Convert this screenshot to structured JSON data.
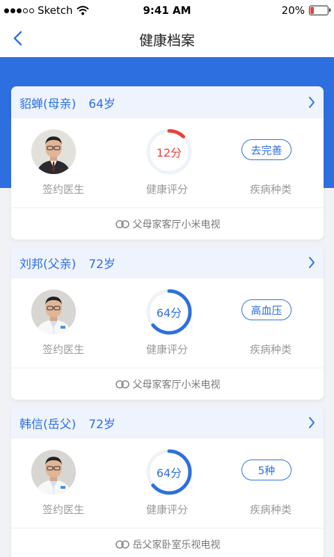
{
  "status_bar": {
    "carrier": "Sketch",
    "time": "9:41 AM",
    "battery": "20%",
    "battery_level": 0.2
  },
  "nav": {
    "title": "健康档案"
  },
  "labels": {
    "doctor": "签约医生",
    "score": "健康评分",
    "disease": "疾病种类"
  },
  "colors": {
    "accent": "#2e6fe0",
    "low_score": "#e8413b"
  },
  "members": [
    {
      "name": "貂蝉(母亲)",
      "age": "64岁",
      "score_text": "12分",
      "score_value": 12,
      "score_color": "#e8413b",
      "disease_tag": "去完善",
      "device": "父母家客厅小米电视",
      "doctor_variant": "suit"
    },
    {
      "name": "刘邦(父亲)",
      "age": "72岁",
      "score_text": "64分",
      "score_value": 64,
      "score_color": "#2e6fe0",
      "disease_tag": "高血压",
      "device": "父母家客厅小米电视",
      "doctor_variant": "coat"
    },
    {
      "name": "韩信(岳父)",
      "age": "72岁",
      "score_text": "64分",
      "score_value": 64,
      "score_color": "#2e6fe0",
      "disease_tag": "5种",
      "device": "岳父家卧室乐视电视",
      "doctor_variant": "coat"
    }
  ]
}
